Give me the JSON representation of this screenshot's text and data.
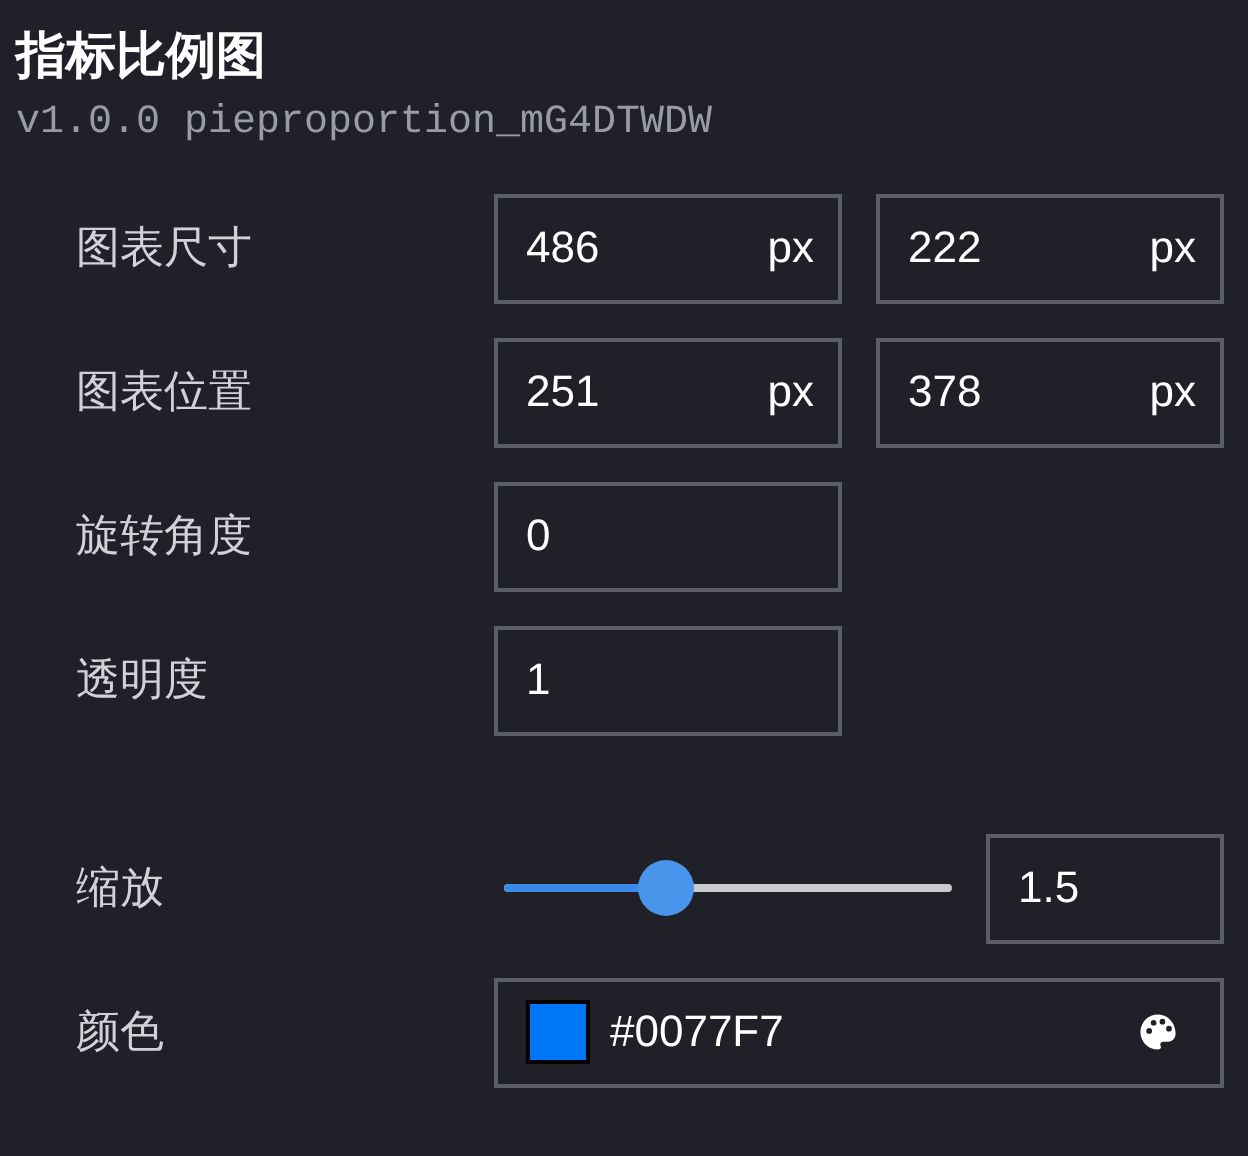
{
  "title": "指标比例图",
  "version": "v1.0.0",
  "component_id": "pieproportion_mG4DTWDW",
  "rows": [
    {
      "kind": "input",
      "label": "图表尺寸",
      "fields": [
        {
          "value": "486",
          "unit": "px"
        },
        {
          "value": "222",
          "unit": "px"
        }
      ]
    },
    {
      "kind": "input",
      "label": "图表位置",
      "fields": [
        {
          "value": "251",
          "unit": "px"
        },
        {
          "value": "378",
          "unit": "px"
        }
      ]
    },
    {
      "kind": "input",
      "label": "旋转角度",
      "fields": [
        {
          "value": "0"
        }
      ]
    },
    {
      "kind": "input",
      "label": "透明度",
      "fields": [
        {
          "value": "1"
        }
      ]
    },
    {
      "kind": "slider",
      "label": "缩放",
      "level": 0.36,
      "fields": [
        {
          "value": "1.5"
        }
      ]
    },
    {
      "kind": "color",
      "label": "颜色",
      "fields": [
        {
          "value": "#0077F7"
        }
      ]
    }
  ]
}
